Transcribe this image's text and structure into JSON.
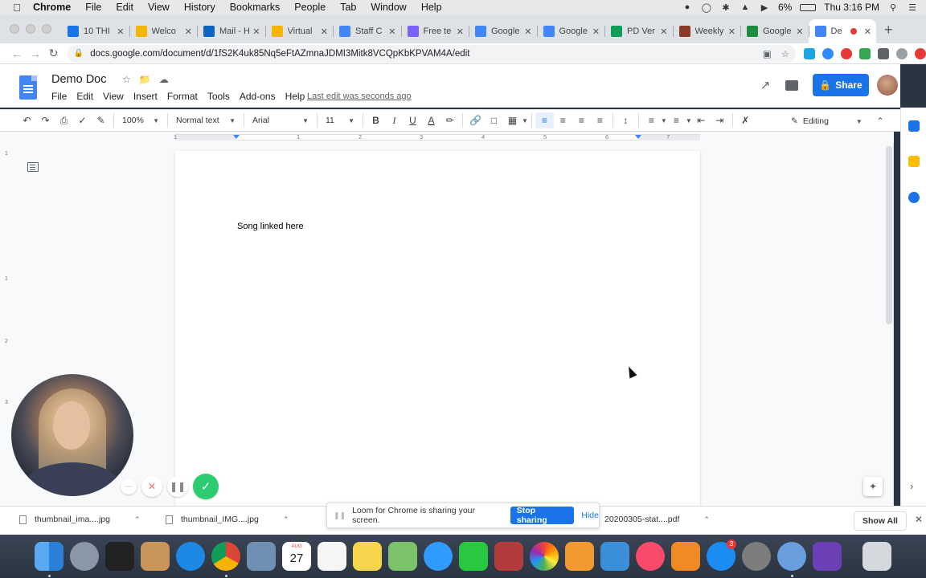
{
  "menubar": {
    "app": "Chrome",
    "items": [
      "File",
      "Edit",
      "View",
      "History",
      "Bookmarks",
      "People",
      "Tab",
      "Window",
      "Help"
    ],
    "battery": "6%",
    "clock": "Thu 3:16 PM"
  },
  "tabs": [
    {
      "label": "10 THI",
      "color": "#1a73e8"
    },
    {
      "label": "Welco",
      "color": "#f4b400"
    },
    {
      "label": "Mail - H",
      "color": "#0a66c2"
    },
    {
      "label": "Virtual",
      "color": "#f4b400"
    },
    {
      "label": "Staff C",
      "color": "#4285f4"
    },
    {
      "label": "Free te",
      "color": "#7b61ff"
    },
    {
      "label": "Google",
      "color": "#4285f4"
    },
    {
      "label": "Google",
      "color": "#4285f4"
    },
    {
      "label": "PD Ver",
      "color": "#0f9d58"
    },
    {
      "label": "Weekly",
      "color": "#8b3a2a"
    },
    {
      "label": "Google",
      "color": "#1e8e3e"
    },
    {
      "label": "De",
      "color": "#4285f4"
    }
  ],
  "address": {
    "url": "docs.google.com/document/d/1fS2K4uk85Nq5eFtAZmnaJDMI3Mitk8VCQpKbKPVAM4A/edit"
  },
  "doc": {
    "title": "Demo Doc",
    "menu": [
      "File",
      "Edit",
      "View",
      "Insert",
      "Format",
      "Tools",
      "Add-ons",
      "Help"
    ],
    "last_edit": "Last edit was seconds ago",
    "share_label": "Share",
    "body_text": "Song linked here"
  },
  "toolbar": {
    "zoom": "100%",
    "style": "Normal text",
    "font": "Arial",
    "size": "11",
    "mode": "Editing"
  },
  "ruler": {
    "h_marks": [
      "1",
      "1",
      "2",
      "3",
      "4",
      "5",
      "6",
      "7"
    ],
    "v_marks": [
      "1",
      "1",
      "2",
      "3"
    ]
  },
  "loom": {
    "message": "Loom for Chrome is sharing your screen.",
    "stop_label": "Stop sharing",
    "hide_label": "Hide"
  },
  "downloads": {
    "items": [
      "thumbnail_ima....jpg",
      "thumbnail_IMG....jpg",
      "20200305-stat....pdf"
    ],
    "show_all": "Show All"
  },
  "dock": {
    "calendar_month": "AUG",
    "calendar_day": "27",
    "appstore_badge": "3"
  },
  "colors": {
    "docs_blue": "#4285f4",
    "share_blue": "#1a73e8",
    "loom_green": "#2ecc71"
  }
}
